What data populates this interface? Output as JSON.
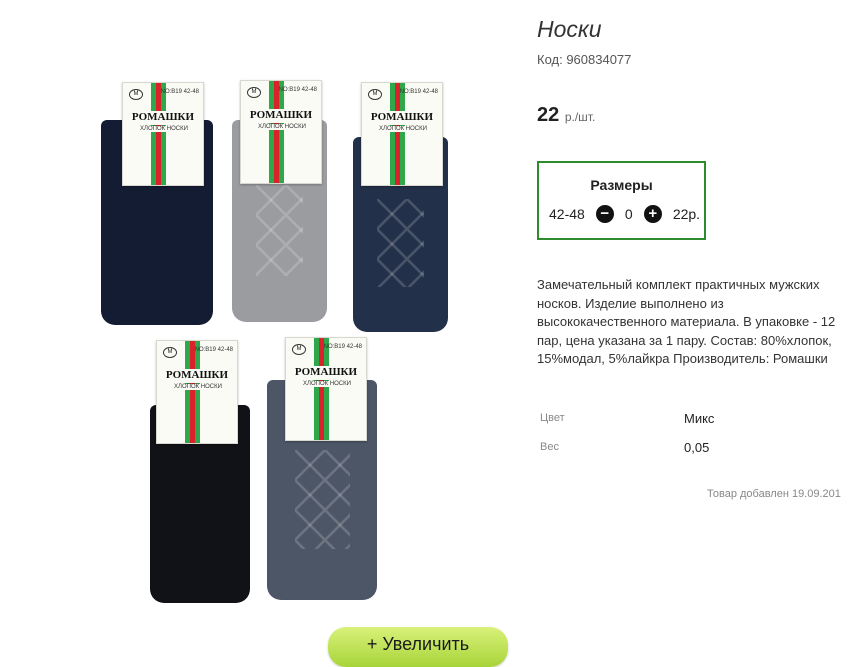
{
  "product": {
    "title": "Носки",
    "code": "Код: 960834077",
    "price": "22",
    "price_unit": "р./шт.",
    "description": "Замечательный комплект практичных мужских носков. Изделие выполнено из высококачественного материала. В упаковке - 12 пар, цена указана за 1 пару. Состав: 80%хлопок, 15%модал, 5%лайкра Производитель: Ромашки",
    "added_date": "Товар добавлен 19.09.201"
  },
  "sizes": {
    "title": "Размеры",
    "row": {
      "size": "42-48",
      "minus_icon": "minus-circle-icon",
      "qty": "0",
      "plus_icon": "plus-circle-icon",
      "price": "22р."
    }
  },
  "attributes": [
    {
      "label": "Цвет",
      "value": "Микс"
    },
    {
      "label": "Вес",
      "value": "0,05"
    }
  ],
  "image": {
    "tag_brand": "РОМАШКИ",
    "tag_sub": "ХЛОПОК НОСКИ",
    "tag_size": "NO:B19 42-48",
    "colors": {
      "navy": "#141c33",
      "grey": "#9a9ca0",
      "darkblue": "#233049",
      "black": "#111217",
      "slate": "#4d5666"
    }
  },
  "zoom_button": {
    "label": "+ Увеличить"
  },
  "colors": {
    "accent_border": "#2e8b2e",
    "button_green": "#b5dc46"
  }
}
